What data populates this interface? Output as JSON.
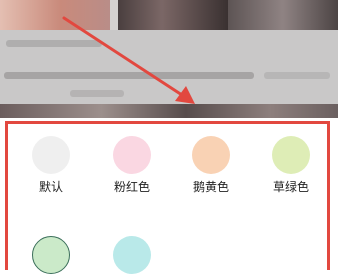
{
  "colors": {
    "annotation_red": "#e2483f"
  },
  "swatches": [
    {
      "label": "默认",
      "color": "#efefef",
      "selected": false
    },
    {
      "label": "粉红色",
      "color": "#fad7e2",
      "selected": false
    },
    {
      "label": "鹅黄色",
      "color": "#f9d2b4",
      "selected": false
    },
    {
      "label": "草绿色",
      "color": "#deedb6",
      "selected": false
    },
    {
      "label": "",
      "color": "#cbeac9",
      "selected": true
    },
    {
      "label": "",
      "color": "#b9e9e9",
      "selected": false
    }
  ]
}
